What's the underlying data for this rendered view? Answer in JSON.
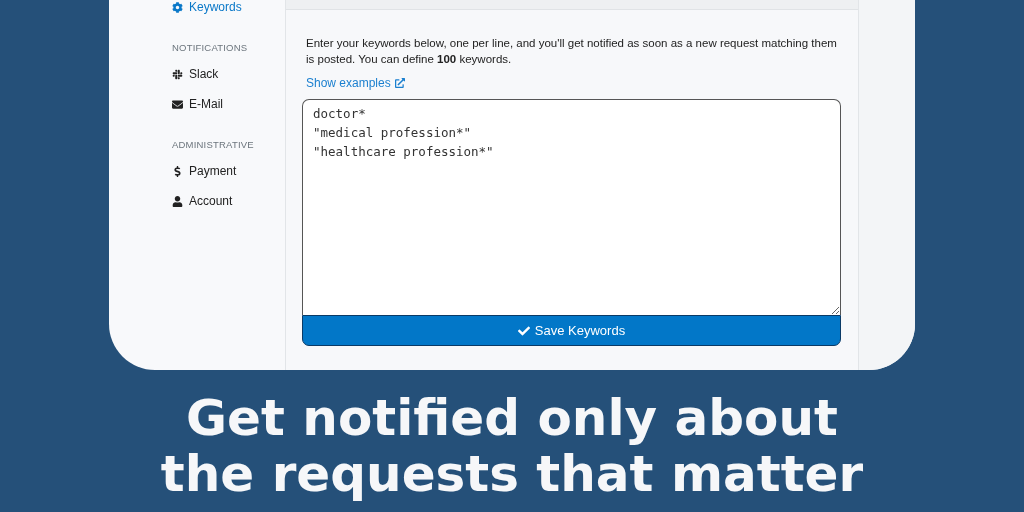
{
  "sidebar": {
    "sections": [
      {
        "items": [
          {
            "label": "Keywords",
            "selected": true
          }
        ]
      },
      {
        "title": "NOTIFICATIONS",
        "items": [
          {
            "label": "Slack",
            "selected": false
          },
          {
            "label": "E-Mail",
            "selected": false
          }
        ]
      },
      {
        "title": "ADMINISTRATIVE",
        "items": [
          {
            "label": "Payment",
            "selected": false
          },
          {
            "label": "Account",
            "selected": false
          }
        ]
      }
    ]
  },
  "main": {
    "description": "Enter your keywords below, one per line, and you'll get notified as soon as a new request matching them is posted. You can define **100** keywords.",
    "link": "Show examples",
    "keywords": [
      "doctor*",
      "\"medical profession*\"",
      "\"healthcare profession*\""
    ],
    "save_button": "Save Keywords"
  },
  "headline": [
    "Get notified only about",
    "the requests that matter"
  ]
}
